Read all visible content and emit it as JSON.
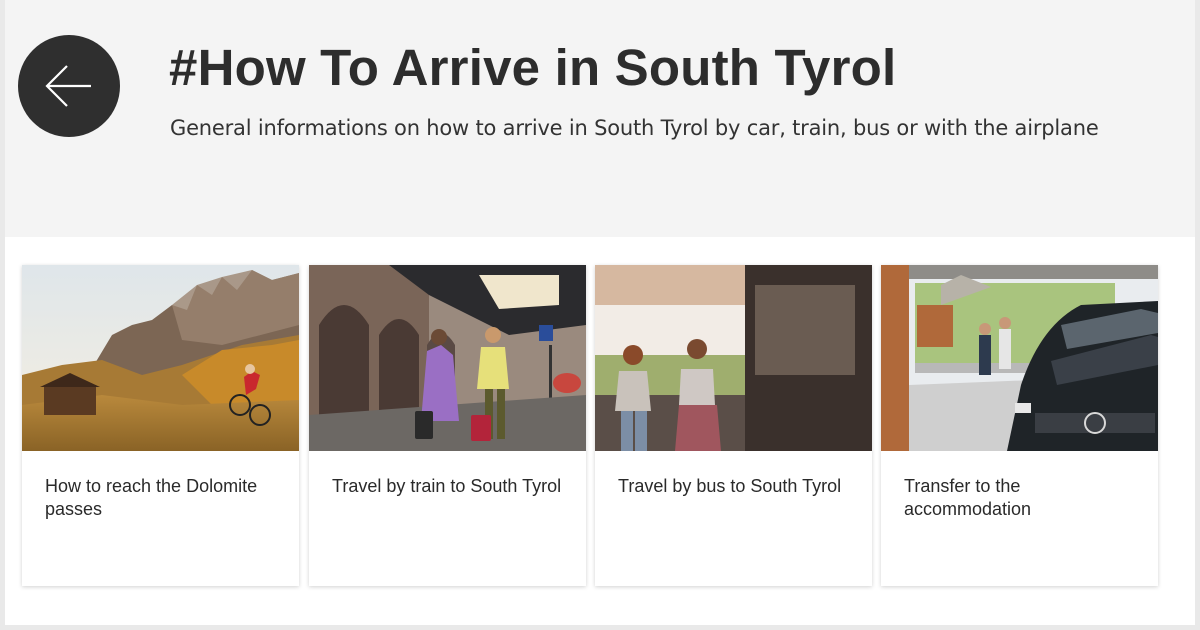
{
  "header": {
    "back_icon": "arrow-left-icon",
    "title": "#How To Arrive in South Tyrol",
    "subtitle": "General informations on how to arrive in South Tyrol by car, train, bus or with the airplane"
  },
  "cards": [
    {
      "label": "How to reach the Dolomite passes",
      "image": "dolomite-mountain-cyclist-image"
    },
    {
      "label": "Travel by train to South Tyrol",
      "image": "train-station-couple-image"
    },
    {
      "label": "Travel by bus to South Tyrol",
      "image": "bus-station-women-image"
    },
    {
      "label": "Transfer to the accommodation",
      "image": "car-transfer-station-image"
    }
  ],
  "colors": {
    "header_bg": "#f4f4f4",
    "back_button": "#2f2f2f",
    "title_text": "#2d2d2d"
  }
}
